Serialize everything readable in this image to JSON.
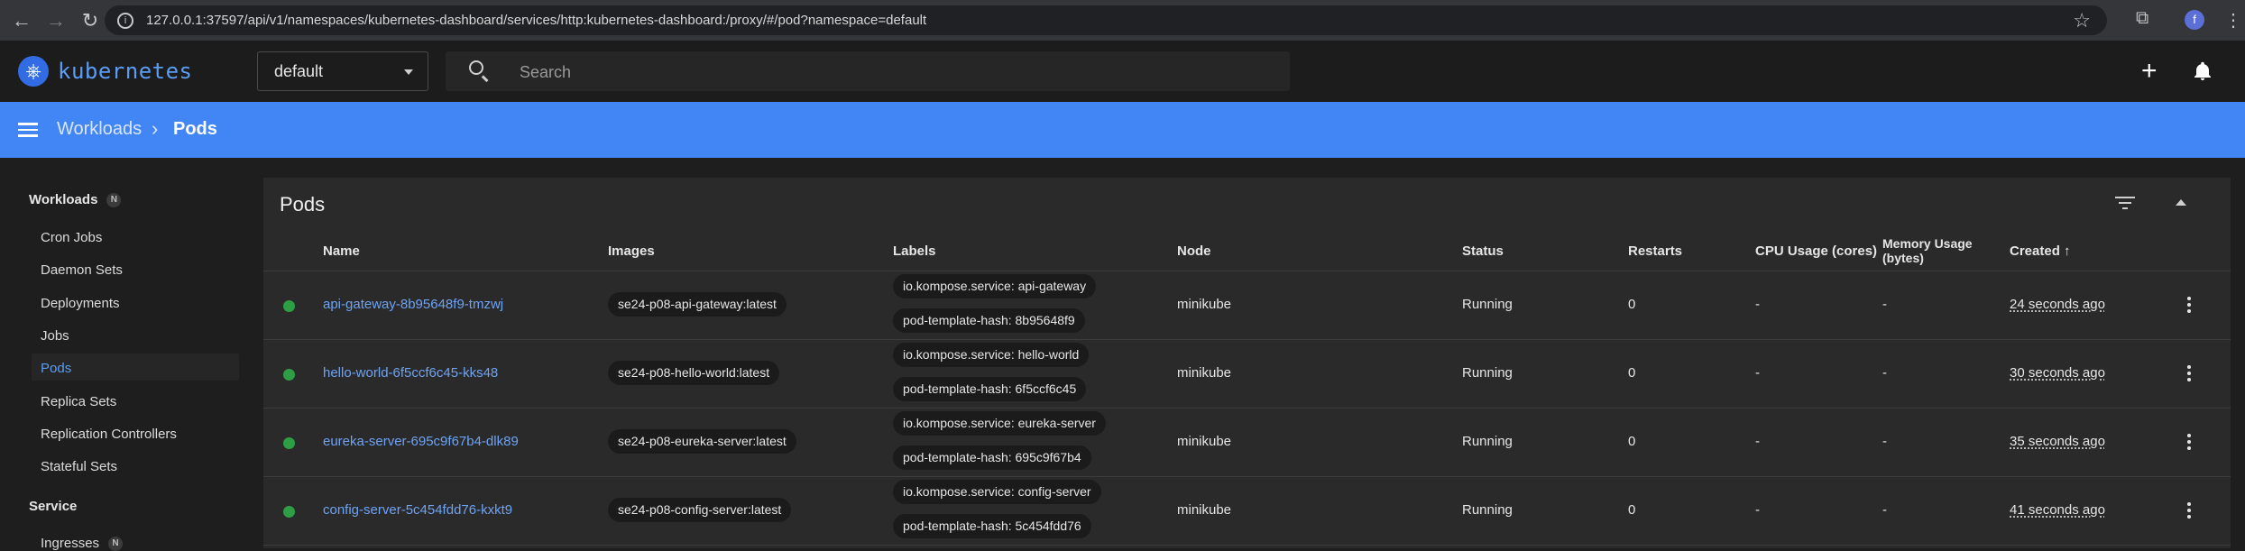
{
  "browser": {
    "url": "127.0.0.1:37597/api/v1/namespaces/kubernetes-dashboard/services/http:kubernetes-dashboard:/proxy/#/pod?namespace=default",
    "profile_initial": "f"
  },
  "toolbar": {
    "brand": "kubernetes",
    "namespace": "default",
    "search_placeholder": "Search"
  },
  "breadcrumb": {
    "parent": "Workloads",
    "current": "Pods"
  },
  "sidebar": {
    "workloads_title": "Workloads",
    "workloads_badge": "N",
    "items": [
      "Cron Jobs",
      "Daemon Sets",
      "Deployments",
      "Jobs",
      "Pods",
      "Replica Sets",
      "Replication Controllers",
      "Stateful Sets"
    ],
    "active_item": "Pods",
    "service_title": "Service",
    "service_items": [
      "Ingresses"
    ],
    "ingresses_badge": "N"
  },
  "pods": {
    "title": "Pods",
    "columns": {
      "name": "Name",
      "images": "Images",
      "labels": "Labels",
      "node": "Node",
      "status": "Status",
      "restarts": "Restarts",
      "cpu": "CPU Usage (cores)",
      "memory_line1": "Memory Usage",
      "memory_line2": "(bytes)",
      "created": "Created"
    },
    "sort_indicator": "↑",
    "rows": [
      {
        "name": "api-gateway-8b95648f9-tmzwj",
        "image": "se24-p08-api-gateway:latest",
        "label1": "io.kompose.service: api-gateway",
        "label2": "pod-template-hash: 8b95648f9",
        "node": "minikube",
        "status": "Running",
        "restarts": "0",
        "cpu": "-",
        "memory": "-",
        "created": "24 seconds ago"
      },
      {
        "name": "hello-world-6f5ccf6c45-kks48",
        "image": "se24-p08-hello-world:latest",
        "label1": "io.kompose.service: hello-world",
        "label2": "pod-template-hash: 6f5ccf6c45",
        "node": "minikube",
        "status": "Running",
        "restarts": "0",
        "cpu": "-",
        "memory": "-",
        "created": "30 seconds ago"
      },
      {
        "name": "eureka-server-695c9f67b4-dlk89",
        "image": "se24-p08-eureka-server:latest",
        "label1": "io.kompose.service: eureka-server",
        "label2": "pod-template-hash: 695c9f67b4",
        "node": "minikube",
        "status": "Running",
        "restarts": "0",
        "cpu": "-",
        "memory": "-",
        "created": "35 seconds ago"
      },
      {
        "name": "config-server-5c454fdd76-kxkt9",
        "image": "se24-p08-config-server:latest",
        "label1": "io.kompose.service: config-server",
        "label2": "pod-template-hash: 5c454fdd76",
        "node": "minikube",
        "status": "Running",
        "restarts": "0",
        "cpu": "-",
        "memory": "-",
        "created": "41 seconds ago"
      }
    ]
  },
  "colors": {
    "accent_blue": "#4285f4",
    "link_blue": "#6ea3f3",
    "status_green": "#2e9e44"
  }
}
